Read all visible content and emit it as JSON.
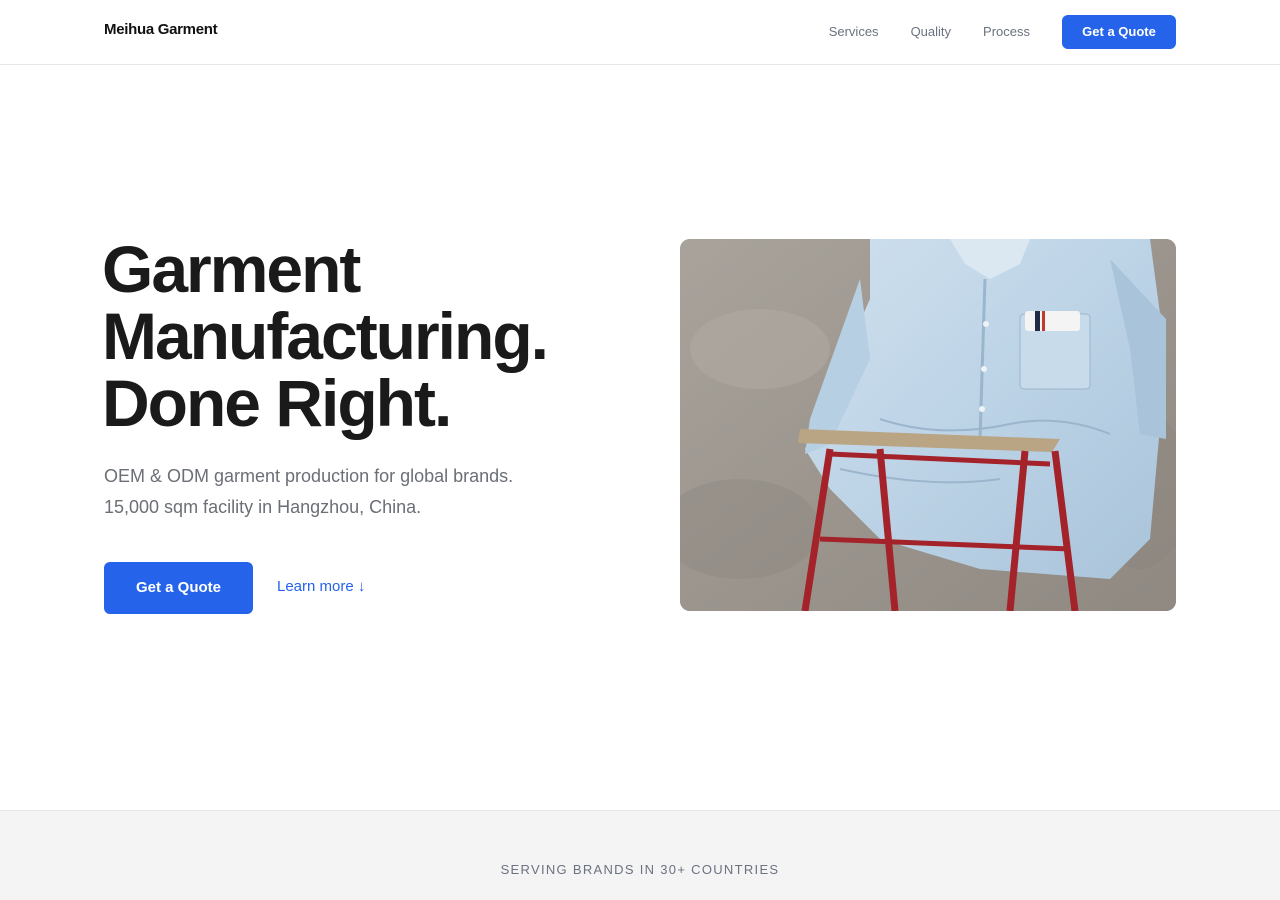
{
  "header": {
    "brand": "Meihua Garment",
    "nav": [
      "Services",
      "Quality",
      "Process"
    ],
    "cta_label": "Get a Quote"
  },
  "hero": {
    "title_lines": [
      "Garment",
      "Manufacturing.",
      "Done Right."
    ],
    "subtitle_lines": [
      "OEM & ODM garment production for global brands.",
      "15,000 sqm facility in Hangzhou, China."
    ],
    "primary_cta": "Get a Quote",
    "secondary_cta": "Learn more ↓"
  },
  "trust": {
    "label": "SERVING BRANDS IN 30+ COUNTRIES"
  },
  "colors": {
    "accent": "#2563eb",
    "title": "#1a1a1a",
    "muted": "#6b7280",
    "band": "#f4f4f5"
  }
}
